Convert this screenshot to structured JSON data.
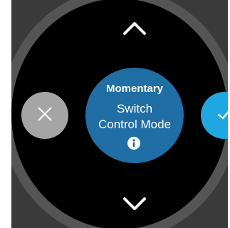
{
  "mode_card": {
    "title": "Momentary",
    "line1": "Switch",
    "line2": "Control Mode"
  },
  "icons": {
    "up": "chevron-up-icon",
    "down": "chevron-down-icon",
    "cancel": "close-icon",
    "confirm": "check-icon",
    "info": "info-icon"
  },
  "colors": {
    "accent": "#1ea7e3",
    "card": "#1f6ea6",
    "cancel": "#a5a5a5",
    "background": "#000000"
  }
}
